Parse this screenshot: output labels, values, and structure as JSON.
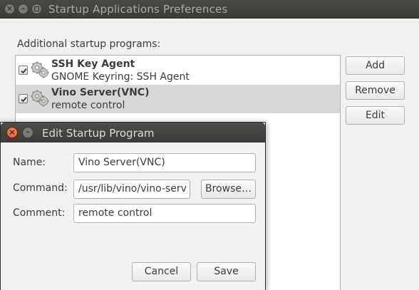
{
  "window": {
    "title": "Startup Applications Preferences",
    "close_glyph": "×",
    "minimize_glyph": "–"
  },
  "main": {
    "section_label": "Additional startup programs:",
    "programs": [
      {
        "name": "SSH Key Agent",
        "description": "GNOME Keyring: SSH Agent",
        "enabled": true,
        "icon": "gears-icon"
      },
      {
        "name": "Vino Server(VNC)",
        "description": "remote control",
        "enabled": true,
        "icon": "gears-icon",
        "selected": true
      }
    ],
    "buttons": {
      "add": "Add",
      "remove": "Remove",
      "edit": "Edit"
    }
  },
  "dialog": {
    "title": "Edit Startup Program",
    "close_glyph": "×",
    "minimize_glyph": "–",
    "name_label": "Name:",
    "name_value": "Vino Server(VNC)",
    "command_label": "Command:",
    "command_value": "/usr/lib/vino/vino-serv",
    "browse_label": "Browse…",
    "comment_label": "Comment:",
    "comment_value": "remote control",
    "cancel_label": "Cancel",
    "save_label": "Save"
  }
}
